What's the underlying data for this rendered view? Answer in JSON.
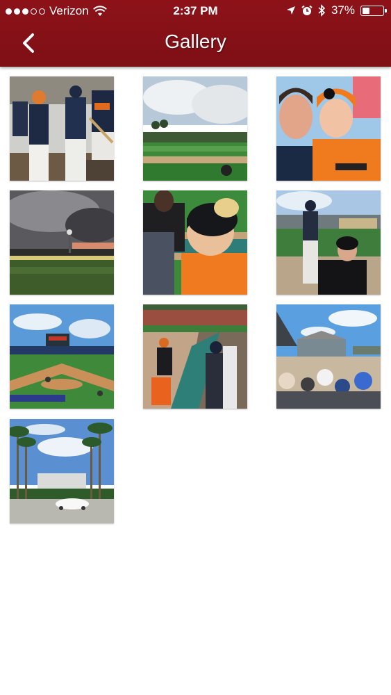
{
  "status_bar": {
    "carrier": "Verizon",
    "time": "2:37 PM",
    "battery_percent": "37%",
    "battery_level": 0.37,
    "signal_bars_filled": 3,
    "signal_bars_total": 5,
    "icons": [
      "wifi-icon",
      "location-arrow-icon",
      "alarm-icon",
      "bluetooth-icon",
      "battery-icon"
    ]
  },
  "nav": {
    "title": "Gallery",
    "back_icon": "chevron-left-icon"
  },
  "theme": {
    "header_color": "#881118",
    "background": "#ffffff"
  },
  "gallery": {
    "photos": [
      {
        "name": "photo-players-dugout"
      },
      {
        "name": "photo-ballpark-field"
      },
      {
        "name": "photo-father-son-selfie"
      },
      {
        "name": "photo-stadium-storm-sky"
      },
      {
        "name": "photo-kids-at-railing"
      },
      {
        "name": "photo-player-and-fan"
      },
      {
        "name": "photo-stadium-scoreboard"
      },
      {
        "name": "photo-autograph-line"
      },
      {
        "name": "photo-crowd-in-stands"
      },
      {
        "name": "photo-palm-tree-entrance"
      }
    ]
  }
}
